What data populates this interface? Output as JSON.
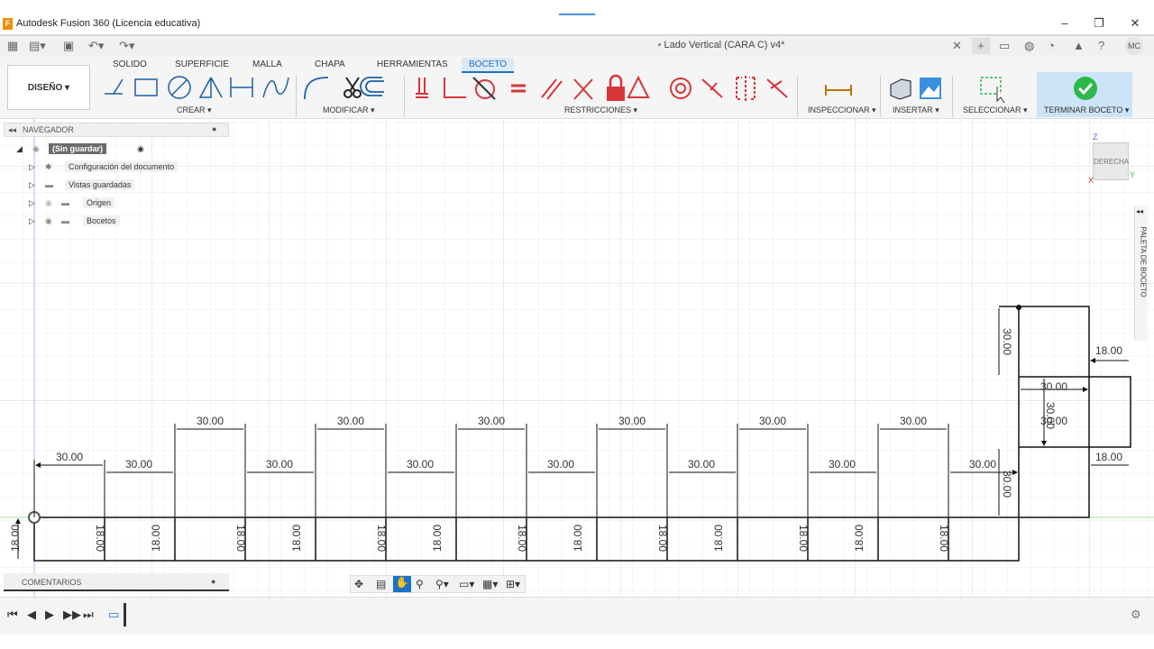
{
  "window": {
    "title": "Autodesk Fusion 360 (Licencia educativa)",
    "minimize": "–",
    "maximize": "❐",
    "close": "✕"
  },
  "document": {
    "tab_title": "Lado Vertical (CARA C) v4*",
    "user_initials": "MC"
  },
  "ribbon": {
    "workspace": "DISEÑO",
    "tabs": [
      "SOLIDO",
      "SUPERFICIE",
      "MALLA",
      "CHAPA",
      "HERRAMIENTAS",
      "BOCETO"
    ],
    "active_tab": "BOCETO",
    "groups": {
      "create": "CREAR",
      "modify": "MODIFICAR",
      "constraints": "RESTRICCIONES",
      "inspect": "INSPECCIONAR",
      "insert": "INSERTAR",
      "select": "SELECCIONAR",
      "finish": "TERMINAR BOCETO"
    }
  },
  "navigator": {
    "header": "NAVEGADOR",
    "root": "(Sin guardar)",
    "items": [
      "Configuración del documento",
      "Vistas guardadas",
      "Origen",
      "Bocetos"
    ]
  },
  "viewcube": {
    "face": "DERECHA",
    "axis_z": "Z",
    "axis_y": "Y",
    "axis_x": "X"
  },
  "sketch_palette": "PALETA DE BOCETO",
  "comments": "COMENTARIOS",
  "dimensions": {
    "top_row": [
      "30.00",
      "30.00",
      "30.00",
      "30.00",
      "30.00",
      "30.00"
    ],
    "mid_row": [
      "30.00",
      "30.00",
      "30.00",
      "30.00",
      "30.00",
      "30.00",
      "30.00",
      "30.00"
    ],
    "vertical": [
      "18.00",
      "18.00",
      "18.00",
      "18.00",
      "18.00",
      "18.00",
      "18.00",
      "18.00",
      "18.00",
      "18.00",
      "18.00",
      "18.00",
      "18.00",
      "18.00",
      "18.00"
    ],
    "right_block": {
      "h1": "30.00",
      "w1": "18.00",
      "w2": "30.00",
      "h2": "30.00",
      "h3": "30.00",
      "w3": "30.00",
      "w4": "18.00",
      "h4": "30.00"
    }
  },
  "colors": {
    "accent": "#1a73c8",
    "finish_bg": "#cce4f7",
    "finish_check": "#2db84b",
    "constraint_red": "#d9343a"
  }
}
